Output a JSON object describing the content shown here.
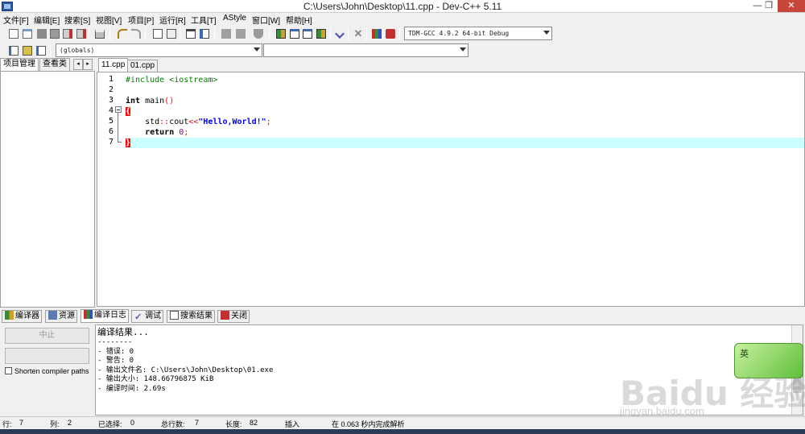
{
  "window": {
    "title": "C:\\Users\\John\\Desktop\\11.cpp - Dev-C++ 5.11",
    "minimize": "—",
    "restore": "❐",
    "close": "✕"
  },
  "menu": [
    "文件[F]",
    "编辑[E]",
    "搜索[S]",
    "视图[V]",
    "项目[P]",
    "运行[R]",
    "工具[T]",
    "AStyle",
    "窗口[W]",
    "帮助[H]"
  ],
  "toolbar": {
    "compiler_select": "TDM-GCC 4.9.2 64-bit Debug",
    "scope_select": "(globals)",
    "symbol_select": ""
  },
  "left_panel": {
    "tabs": [
      "项目管理",
      "查看类"
    ],
    "nav_prev": "◂",
    "nav_next": "▸"
  },
  "editor": {
    "tabs": [
      "11.cpp",
      "01.cpp"
    ],
    "active_tab": "11.cpp",
    "line_numbers": [
      "1",
      "2",
      "3",
      "4",
      "5",
      "6",
      "7"
    ],
    "lines": {
      "l1": "#include <iostream>",
      "l3_kw": "int",
      "l3_rest": " main",
      "l3_parens": "()",
      "l4": "{",
      "l5_indent": "    std",
      "l5_op1": "::",
      "l5_cout": "cout",
      "l5_op2": "<<",
      "l5_str": "\"Hello,World!\"",
      "l5_semi": ";",
      "l6_indent": "    ",
      "l6_kw": "return",
      "l6_num": " 0",
      "l6_semi": ";",
      "l7": "}"
    }
  },
  "bottom_tabs": [
    "编译器",
    "资源",
    "编译日志",
    "调试",
    "搜索结果",
    "关闭"
  ],
  "bottom_panel": {
    "abort_button": "中止",
    "progress": "",
    "shorten_label": "Shorten compiler paths",
    "log": [
      "编译结果...",
      "--------",
      "- 错误: 0",
      "- 警告: 0",
      "- 输出文件名: C:\\Users\\John\\Desktop\\01.exe",
      "- 输出大小: 148.66796875 KiB",
      "- 编译时间: 2.69s"
    ]
  },
  "status": {
    "row_label": "行:",
    "row_value": "7",
    "col_label": "列:",
    "col_value": "2",
    "sel_label": "已选择:",
    "sel_value": "0",
    "lines_label": "总行数:",
    "lines_value": "7",
    "len_label": "长度:",
    "len_value": "82",
    "mode": "插入",
    "parse": "在 0.063 秒内完成解析"
  },
  "overlay": {
    "ime_label": "英",
    "watermark": "Baidu 经验",
    "watermark_url": "jingyan.baidu.com"
  },
  "colors": {
    "current_line": "#ccffff",
    "brace_highlight": "#ff0000",
    "string": "#0000ff",
    "preprocessor": "#008000",
    "number": "#800080"
  }
}
